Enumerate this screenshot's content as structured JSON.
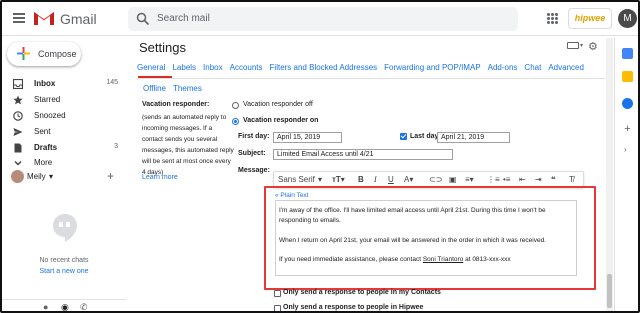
{
  "header": {
    "app_name": "Gmail",
    "search_placeholder": "Search mail",
    "brand_badge": "hipwee",
    "account_initial": "M"
  },
  "sidebar": {
    "compose_label": "Compose",
    "items": [
      {
        "label": "Inbox",
        "count": "145",
        "icon": "inbox-icon",
        "bold": true
      },
      {
        "label": "Starred",
        "count": "",
        "icon": "star-icon",
        "bold": false
      },
      {
        "label": "Snoozed",
        "count": "",
        "icon": "clock-icon",
        "bold": false
      },
      {
        "label": "Sent",
        "count": "",
        "icon": "send-icon",
        "bold": false
      },
      {
        "label": "Drafts",
        "count": "3",
        "icon": "draft-icon",
        "bold": true
      },
      {
        "label": "More",
        "count": "",
        "icon": "chevron-down-icon",
        "bold": false
      }
    ],
    "hangouts_user": "Meily",
    "no_chats": "No recent chats",
    "start_new": "Start a new one"
  },
  "settings": {
    "title": "Settings",
    "tabs_row1": [
      "General",
      "Labels",
      "Inbox",
      "Accounts",
      "Filters and Blocked Addresses",
      "Forwarding and POP/IMAP",
      "Add-ons",
      "Chat",
      "Advanced"
    ],
    "tabs_row2": [
      "Offline",
      "Themes"
    ],
    "active_tab": "General"
  },
  "vacation": {
    "heading": "Vacation responder:",
    "description": "(sends an automated reply to incoming messages. If a contact sends you several messages, this automated reply will be sent at most once every 4 days)",
    "learn_more": "Learn more",
    "off_label": "Vacation responder off",
    "on_label": "Vacation responder on",
    "first_day_label": "First day:",
    "first_day_value": "April 15, 2019",
    "last_day_label": "Last day:",
    "last_day_value": "April 21, 2019",
    "last_day_checked": true,
    "subject_label": "Subject:",
    "subject_value": "Limited Email Access until 4/21",
    "message_label": "Message:",
    "font_name": "Sans Serif",
    "plain_text_link": "« Plain Text",
    "message_p1": "I'm away of the office. I'll have limited email access until April 21st. During this time I won't be responding to emails.",
    "message_p2": "When I return on April 21st, your email will be answered in the order in which it was received.",
    "message_p3_pre": "If you need immediate assistance, please contact ",
    "message_p3_name": "Soni Triantoro",
    "message_p3_post": " at 0813-xxx-xxx",
    "contacts_only": "Only send a response to people in my Contacts",
    "domain_only": "Only send a response to people in Hipwee"
  },
  "colors": {
    "accent": "#1a73e8",
    "highlight_box": "#e53935",
    "gmail_red": "#ea4335"
  }
}
